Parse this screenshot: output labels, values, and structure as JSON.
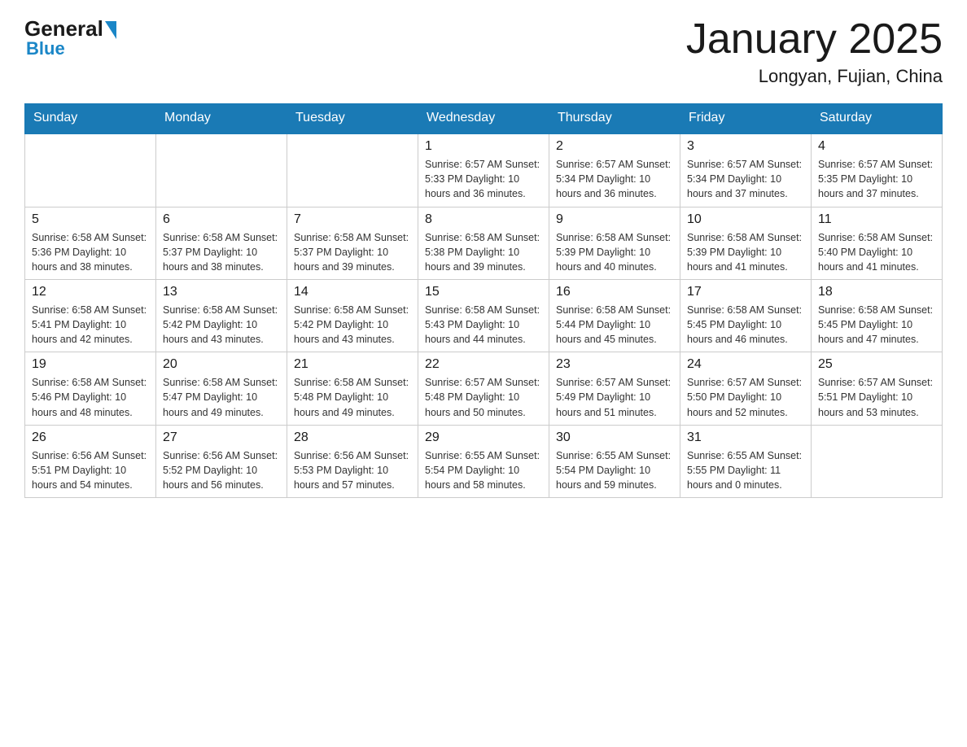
{
  "logo": {
    "general": "General",
    "blue": "Blue"
  },
  "header": {
    "title": "January 2025",
    "subtitle": "Longyan, Fujian, China"
  },
  "weekdays": [
    "Sunday",
    "Monday",
    "Tuesday",
    "Wednesday",
    "Thursday",
    "Friday",
    "Saturday"
  ],
  "weeks": [
    [
      {
        "day": "",
        "info": ""
      },
      {
        "day": "",
        "info": ""
      },
      {
        "day": "",
        "info": ""
      },
      {
        "day": "1",
        "info": "Sunrise: 6:57 AM\nSunset: 5:33 PM\nDaylight: 10 hours\nand 36 minutes."
      },
      {
        "day": "2",
        "info": "Sunrise: 6:57 AM\nSunset: 5:34 PM\nDaylight: 10 hours\nand 36 minutes."
      },
      {
        "day": "3",
        "info": "Sunrise: 6:57 AM\nSunset: 5:34 PM\nDaylight: 10 hours\nand 37 minutes."
      },
      {
        "day": "4",
        "info": "Sunrise: 6:57 AM\nSunset: 5:35 PM\nDaylight: 10 hours\nand 37 minutes."
      }
    ],
    [
      {
        "day": "5",
        "info": "Sunrise: 6:58 AM\nSunset: 5:36 PM\nDaylight: 10 hours\nand 38 minutes."
      },
      {
        "day": "6",
        "info": "Sunrise: 6:58 AM\nSunset: 5:37 PM\nDaylight: 10 hours\nand 38 minutes."
      },
      {
        "day": "7",
        "info": "Sunrise: 6:58 AM\nSunset: 5:37 PM\nDaylight: 10 hours\nand 39 minutes."
      },
      {
        "day": "8",
        "info": "Sunrise: 6:58 AM\nSunset: 5:38 PM\nDaylight: 10 hours\nand 39 minutes."
      },
      {
        "day": "9",
        "info": "Sunrise: 6:58 AM\nSunset: 5:39 PM\nDaylight: 10 hours\nand 40 minutes."
      },
      {
        "day": "10",
        "info": "Sunrise: 6:58 AM\nSunset: 5:39 PM\nDaylight: 10 hours\nand 41 minutes."
      },
      {
        "day": "11",
        "info": "Sunrise: 6:58 AM\nSunset: 5:40 PM\nDaylight: 10 hours\nand 41 minutes."
      }
    ],
    [
      {
        "day": "12",
        "info": "Sunrise: 6:58 AM\nSunset: 5:41 PM\nDaylight: 10 hours\nand 42 minutes."
      },
      {
        "day": "13",
        "info": "Sunrise: 6:58 AM\nSunset: 5:42 PM\nDaylight: 10 hours\nand 43 minutes."
      },
      {
        "day": "14",
        "info": "Sunrise: 6:58 AM\nSunset: 5:42 PM\nDaylight: 10 hours\nand 43 minutes."
      },
      {
        "day": "15",
        "info": "Sunrise: 6:58 AM\nSunset: 5:43 PM\nDaylight: 10 hours\nand 44 minutes."
      },
      {
        "day": "16",
        "info": "Sunrise: 6:58 AM\nSunset: 5:44 PM\nDaylight: 10 hours\nand 45 minutes."
      },
      {
        "day": "17",
        "info": "Sunrise: 6:58 AM\nSunset: 5:45 PM\nDaylight: 10 hours\nand 46 minutes."
      },
      {
        "day": "18",
        "info": "Sunrise: 6:58 AM\nSunset: 5:45 PM\nDaylight: 10 hours\nand 47 minutes."
      }
    ],
    [
      {
        "day": "19",
        "info": "Sunrise: 6:58 AM\nSunset: 5:46 PM\nDaylight: 10 hours\nand 48 minutes."
      },
      {
        "day": "20",
        "info": "Sunrise: 6:58 AM\nSunset: 5:47 PM\nDaylight: 10 hours\nand 49 minutes."
      },
      {
        "day": "21",
        "info": "Sunrise: 6:58 AM\nSunset: 5:48 PM\nDaylight: 10 hours\nand 49 minutes."
      },
      {
        "day": "22",
        "info": "Sunrise: 6:57 AM\nSunset: 5:48 PM\nDaylight: 10 hours\nand 50 minutes."
      },
      {
        "day": "23",
        "info": "Sunrise: 6:57 AM\nSunset: 5:49 PM\nDaylight: 10 hours\nand 51 minutes."
      },
      {
        "day": "24",
        "info": "Sunrise: 6:57 AM\nSunset: 5:50 PM\nDaylight: 10 hours\nand 52 minutes."
      },
      {
        "day": "25",
        "info": "Sunrise: 6:57 AM\nSunset: 5:51 PM\nDaylight: 10 hours\nand 53 minutes."
      }
    ],
    [
      {
        "day": "26",
        "info": "Sunrise: 6:56 AM\nSunset: 5:51 PM\nDaylight: 10 hours\nand 54 minutes."
      },
      {
        "day": "27",
        "info": "Sunrise: 6:56 AM\nSunset: 5:52 PM\nDaylight: 10 hours\nand 56 minutes."
      },
      {
        "day": "28",
        "info": "Sunrise: 6:56 AM\nSunset: 5:53 PM\nDaylight: 10 hours\nand 57 minutes."
      },
      {
        "day": "29",
        "info": "Sunrise: 6:55 AM\nSunset: 5:54 PM\nDaylight: 10 hours\nand 58 minutes."
      },
      {
        "day": "30",
        "info": "Sunrise: 6:55 AM\nSunset: 5:54 PM\nDaylight: 10 hours\nand 59 minutes."
      },
      {
        "day": "31",
        "info": "Sunrise: 6:55 AM\nSunset: 5:55 PM\nDaylight: 11 hours\nand 0 minutes."
      },
      {
        "day": "",
        "info": ""
      }
    ]
  ]
}
